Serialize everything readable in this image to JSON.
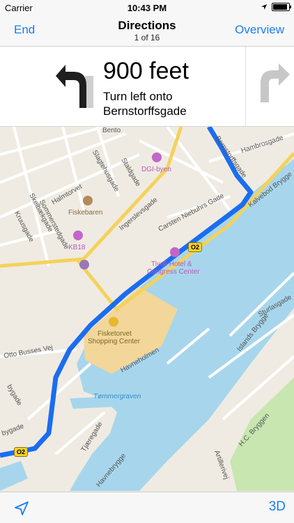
{
  "status": {
    "carrier": "Carrier",
    "time": "10:43 PM"
  },
  "nav": {
    "end": "End",
    "title": "Directions",
    "step": "1 of 16",
    "overview": "Overview"
  },
  "instruction": {
    "distance": "900 feet",
    "line1": "Turn left onto",
    "line2": "Bernstorffsgade"
  },
  "map": {
    "streets": {
      "bento": "Bento",
      "hambrosgade": "Hambrosgade",
      "bernstorffsgade": "Bernstorffsgade",
      "halmtorvet": "Halmtorvet",
      "slagtehusgade": "Slagtehusgade",
      "staldgade": "Staldgade",
      "ingerslevsgade": "Ingerslevsgade",
      "carsten": "Carsten Niebuhrs Gade",
      "kalvebod": "Kalvebod Brygge",
      "skelbaekgade": "Skelbækgade",
      "sommerstedgade": "Sommerstedgade",
      "kruusegade": "Kruusgade",
      "otto": "Otto Busses Vej",
      "havneholmen": "Havneholmen",
      "tjaeregade": "Tjæregade",
      "islands": "Islands Brygge",
      "sturlasgade": "Sturlasgade",
      "htbryggen": "H.C. Bryggen",
      "artillerivej": "Artillerivej",
      "bygade": "bygade",
      "havnebrygge": "Havnebrygge",
      "bygade2": "bygade"
    },
    "pois": {
      "dgi": "DGI-byen",
      "fiskebaren": "Fiskebaren",
      "kb18": "KB18",
      "tivoli1": "Tivoli Hotel &",
      "tivoli2": "Congress Center",
      "fisketorvet1": "Fisketorvet",
      "fisketorvet2": "Shopping Center"
    },
    "water_label": "Tømmergraven",
    "route_shield": "O2"
  },
  "bottom": {
    "location_icon": "location-arrow-icon",
    "mode": "3D"
  },
  "colors": {
    "accent": "#1a7cf5",
    "route": "#1b6df0",
    "water": "#a7d6ec",
    "park": "#c8e6b0",
    "land": "#efebe2"
  }
}
